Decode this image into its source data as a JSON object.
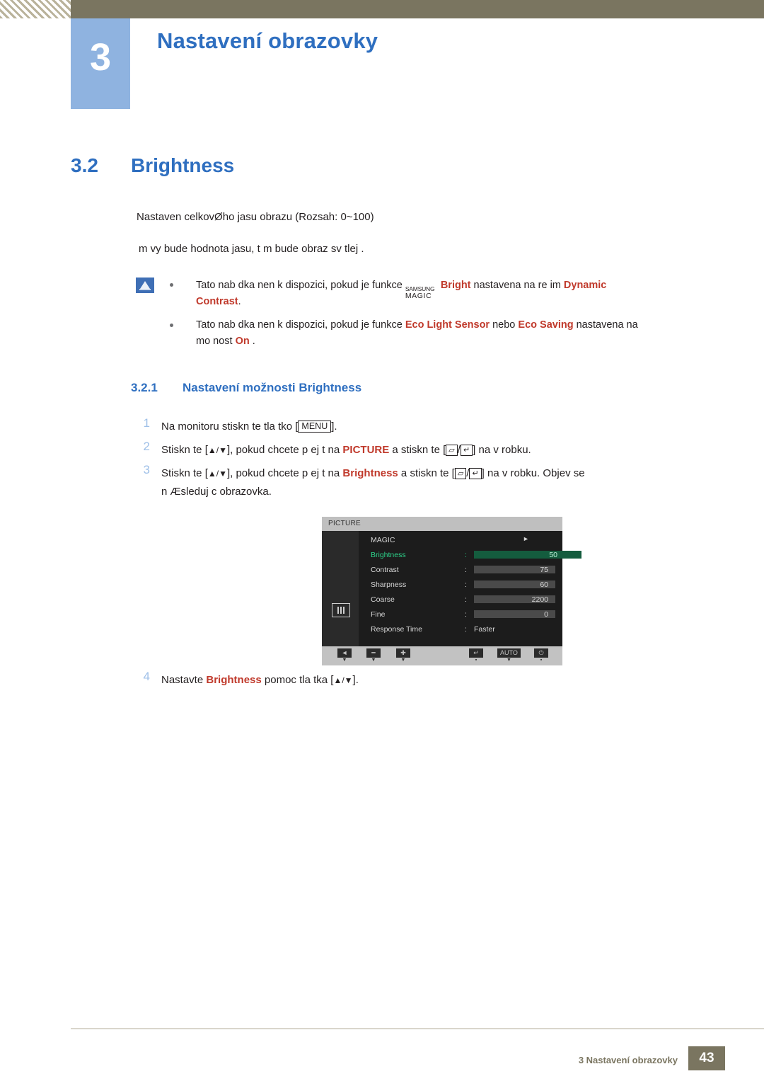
{
  "header": {
    "chapter_number": "3",
    "chapter_title": "Nastavení obrazovky"
  },
  "section": {
    "number": "3.2",
    "title": "Brightness"
  },
  "body": {
    "paragraph1": "Nastaven  celkovØho jasu obrazu (Rozsah: 0~100)",
    "paragraph2": " m vy    bude hodnota jasu, t m bude obraz sv tlej  ."
  },
  "note": {
    "icon": "note-icon",
    "line1_pre": "Tato nab dka nen  k dispozici, pokud je funkce ",
    "line1_magic_top": "SAMSUNG",
    "line1_magic_bottom": "MAGIC",
    "line1_bright": "Bright",
    "line1_mid": " nastavena na re im ",
    "line1_red1": "Dynamic",
    "line1_red2": "Contrast",
    "line1_end": ".",
    "line2_pre": "Tato nab dka nen  k dispozici, pokud je funkce ",
    "line2_red1": "Eco Light Sensor",
    "line2_mid": " nebo ",
    "line2_red2": "Eco Saving",
    "line2_post": " nastavena na",
    "line2_second_pre": "mo nost ",
    "line2_second_red": "On",
    "line2_second_end": " ."
  },
  "subsection": {
    "number": "3.2.1",
    "title": "Nastavení možnosti Brightness"
  },
  "steps": [
    {
      "num": "1",
      "pre": "Na monitoru stiskn te tla  tko [",
      "key": "MENU",
      "post": "]."
    },
    {
      "num": "2",
      "pre": "Stiskn te [",
      "arrows": "▲/▼",
      "mid": "], pokud chcete p ej t na ",
      "red": "PICTURE",
      "mid2": " a stiskn te [",
      "g1": "▱",
      "slash": "/",
      "g2": "↵",
      "post": "] na v robku."
    },
    {
      "num": "3",
      "pre": "Stiskn te [",
      "arrows": "▲/▼",
      "mid": "], pokud chcete p ej t na ",
      "red": "Brightness",
      "mid2": " a stiskn te [",
      "g1": "▱",
      "slash": "/",
      "g2": "↵",
      "post": "] na v robku. Objev  se",
      "line2": "n Æsleduj c  obrazovka."
    },
    {
      "num": "4",
      "pre": "Nastavte ",
      "red": "Brightness",
      "mid": " pomoc  tla  tka [",
      "arrows": "▲/▼",
      "post": "]."
    }
  ],
  "osd": {
    "title": "PICTURE",
    "left_icon": "picture-icon",
    "rows": [
      {
        "label": "MAGIC",
        "colon": "",
        "type": "arrow",
        "arrow": "►",
        "value": ""
      },
      {
        "label": "Brightness",
        "colon": ":",
        "type": "bar-selected",
        "value": "50",
        "fill_percent": 50
      },
      {
        "label": "Contrast",
        "colon": ":",
        "type": "bar",
        "value": "75",
        "fill_percent": 75
      },
      {
        "label": "Sharpness",
        "colon": ":",
        "type": "bar",
        "value": "60",
        "fill_percent": 60
      },
      {
        "label": "Coarse",
        "colon": ":",
        "type": "bar",
        "value": "2200",
        "fill_percent": 60
      },
      {
        "label": "Fine",
        "colon": ":",
        "type": "bar",
        "value": "0",
        "fill_percent": 0
      },
      {
        "label": "Response Time",
        "colon": ":",
        "type": "text",
        "value": "Faster"
      }
    ],
    "buttons": [
      {
        "icon": "◄",
        "label": "▼"
      },
      {
        "icon": "━",
        "label": "▼"
      },
      {
        "icon": "✚",
        "label": "▼"
      },
      {
        "icon": "↵",
        "label": "▪"
      },
      {
        "icon": "AUTO",
        "label": "▼"
      },
      {
        "icon": "⏻",
        "label": "▪"
      }
    ]
  },
  "footer": {
    "text": "3 Nastavení obrazovky",
    "page": "43"
  },
  "colors": {
    "accent_blue": "#2f6fc0",
    "header_bar": "#7a7560",
    "red": "#c0392b",
    "osd_green": "#1fc77e"
  }
}
